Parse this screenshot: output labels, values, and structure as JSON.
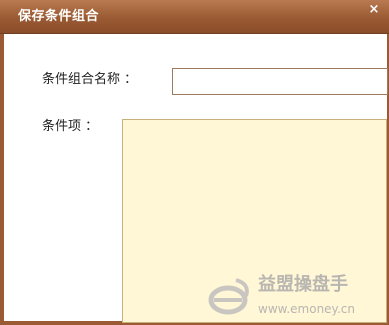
{
  "dialog": {
    "title": "保存条件组合",
    "close_symbol": "×"
  },
  "form": {
    "name_label": "条件组合名称 ：",
    "name_value": "",
    "items_label": "条件项 ："
  },
  "watermark": {
    "brand": "益盟操盘手",
    "url": "www.emoney.cn",
    "logo_icon": "emoney-logo-icon"
  },
  "colors": {
    "titlebar": "#9a5a33",
    "items_background": "#fff7d6"
  }
}
